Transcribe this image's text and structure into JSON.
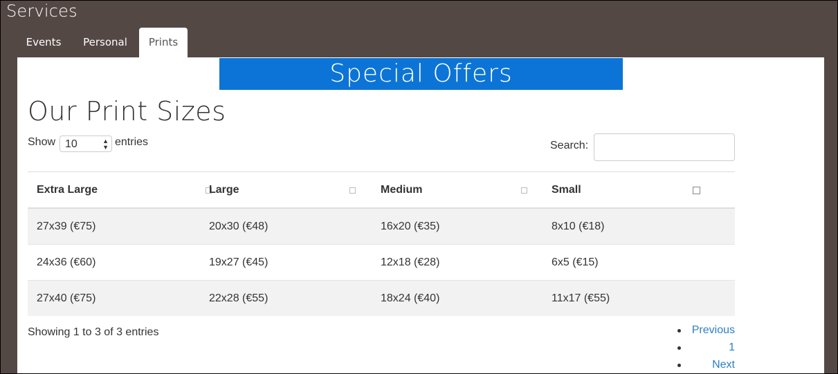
{
  "app": {
    "title": "Services"
  },
  "tabs": [
    {
      "label": "Events"
    },
    {
      "label": "Personal"
    },
    {
      "label": "Prints"
    }
  ],
  "banner": {
    "text": "Special Offers",
    "color": "#0c74d6"
  },
  "heading": "Our Print Sizes",
  "length": {
    "prefix": "Show",
    "value": "10",
    "suffix": "entries"
  },
  "search": {
    "label": "Search:",
    "value": ""
  },
  "table": {
    "columns": [
      "Extra Large",
      "Large",
      "Medium",
      "Small"
    ],
    "rows": [
      [
        "27x39 (€75)",
        "20x30 (€48)",
        "16x20 (€35)",
        "8x10 (€18)"
      ],
      [
        "24x36 (€60)",
        "19x27 (€45)",
        "12x18 (€28)",
        "6x5 (€15)"
      ],
      [
        "27x40 (€75)",
        "22x28 (€55)",
        "18x24 (€40)",
        "11x17 (€55)"
      ]
    ]
  },
  "info": "Showing 1 to 3 of 3 entries",
  "pagination": {
    "previous": "Previous",
    "page": "1",
    "next": "Next"
  }
}
